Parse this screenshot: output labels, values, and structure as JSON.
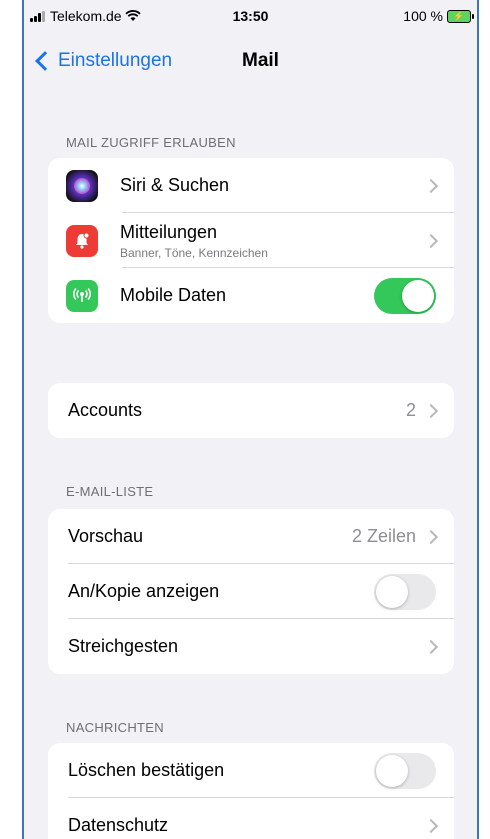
{
  "status_bar": {
    "carrier": "Telekom.de",
    "time": "13:50",
    "battery": "100 %"
  },
  "nav": {
    "back_label": "Einstellungen",
    "title": "Mail"
  },
  "sections": {
    "allow_access": {
      "header": "MAIL ZUGRIFF ERLAUBEN",
      "siri": {
        "label": "Siri & Suchen",
        "icon": "siri-icon"
      },
      "notifications": {
        "label": "Mitteilungen",
        "subtitle": "Banner, Töne, Kennzeichen",
        "icon": "bell-icon"
      },
      "mobile_data": {
        "label": "Mobile Daten",
        "icon": "antenna-icon",
        "toggle_on": true
      }
    },
    "accounts": {
      "label": "Accounts",
      "value": "2"
    },
    "mail_list": {
      "header": "E-MAIL-LISTE",
      "preview": {
        "label": "Vorschau",
        "value": "2 Zeilen"
      },
      "show_to_cc": {
        "label": "An/Kopie anzeigen",
        "toggle_on": false
      },
      "swipe": {
        "label": "Streichgesten"
      }
    },
    "messages": {
      "header": "NACHRICHTEN",
      "confirm_delete": {
        "label": "Löschen bestätigen",
        "toggle_on": false
      },
      "privacy": {
        "label": "Datenschutz"
      }
    }
  },
  "colors": {
    "accent": "#1a74e8",
    "toggle_on": "#34c759",
    "background": "#f1f1f6"
  }
}
